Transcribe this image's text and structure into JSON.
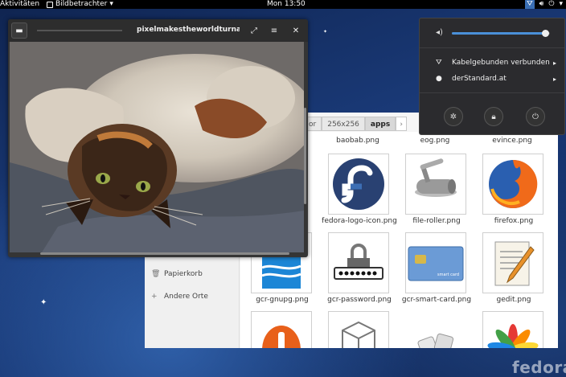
{
  "topbar": {
    "activities": "Aktivitäten",
    "app_menu": "Bildbetrachter",
    "clock": "Mon 13:50",
    "icons": [
      "network-icon",
      "volume-icon",
      "power-icon"
    ]
  },
  "status_menu": {
    "volume_level": 0.95,
    "items": [
      {
        "icon": "network-wired-icon",
        "label": "Kabelgebunden verbunden"
      },
      {
        "icon": "user-icon",
        "label": "derStandard.at"
      }
    ],
    "buttons": [
      "settings-icon",
      "lock-icon",
      "power-icon"
    ]
  },
  "viewer": {
    "title": "pixelmakestheworldturnarou…"
  },
  "files": {
    "path": [
      "…or",
      "256x256",
      "apps"
    ],
    "sidebar": [
      {
        "icon": "trash-icon",
        "label": "Papierkorb"
      },
      {
        "icon": "plus-icon",
        "label": "Andere Orte"
      }
    ],
    "top_labels": [
      "baobab.png",
      "eog.png",
      "evince.png"
    ],
    "rows": [
      [
        "fedora-logo-icon.png",
        "file-roller.png",
        "firefox.png"
      ],
      [
        "gcr-gnupg.png",
        "gcr-password.png",
        "gcr-smart-card.png",
        "gedit.png"
      ]
    ],
    "smart_card_text": "smart card"
  },
  "watermark": "fedora",
  "colors": {
    "accent": "#4a90d9",
    "topbar": "#000000",
    "menu_bg": "#2b2b2e"
  }
}
